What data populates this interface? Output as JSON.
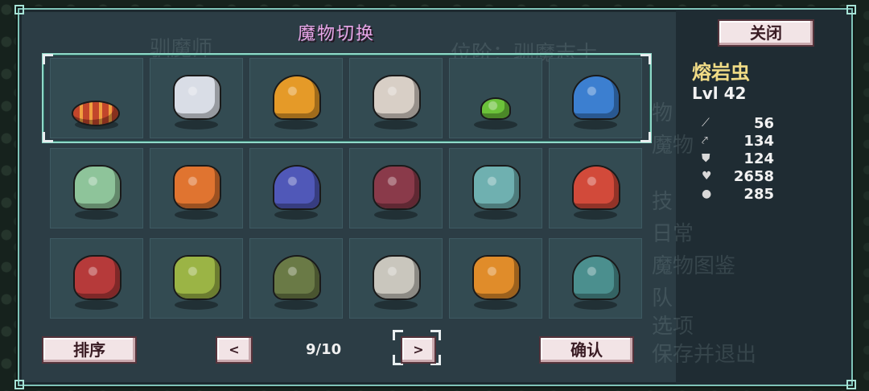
{
  "dialog": {
    "title": "魔物切换",
    "close_label": "关闭",
    "sort_label": "排序",
    "confirm_label": "确认",
    "prev_label": "<",
    "next_label": ">",
    "page_indicator": "9/10"
  },
  "selected_monster": {
    "name": "熔岩虫",
    "level": "Lvl 42",
    "stats": [
      {
        "icon": "sword-icon",
        "value": "56"
      },
      {
        "icon": "pickaxe-icon",
        "value": "134"
      },
      {
        "icon": "shield-icon",
        "value": "124"
      },
      {
        "icon": "heart-icon",
        "value": "2658"
      },
      {
        "icon": "mana-icon",
        "value": "285"
      }
    ]
  },
  "monsters": [
    {
      "id": "lava-worm",
      "color": "#c2462b"
    },
    {
      "id": "cat-knight",
      "color": "#d9dde6"
    },
    {
      "id": "fire-bird",
      "color": "#e59a28"
    },
    {
      "id": "rock-golem",
      "color": "#d8cfc6"
    },
    {
      "id": "green-slime",
      "color": "#6cc23a"
    },
    {
      "id": "blue-wolf",
      "color": "#3c7fd0"
    },
    {
      "id": "plant-beast",
      "color": "#8ec49a"
    },
    {
      "id": "magma-lion",
      "color": "#e07430"
    },
    {
      "id": "shadow-mage",
      "color": "#5058b8"
    },
    {
      "id": "horned-demon",
      "color": "#8a3a4a"
    },
    {
      "id": "water-spirit",
      "color": "#6fb0b0"
    },
    {
      "id": "mushroom-druid",
      "color": "#d24a3a"
    },
    {
      "id": "red-drake",
      "color": "#b63a3a"
    },
    {
      "id": "plume-dino",
      "color": "#9bb445"
    },
    {
      "id": "sea-turtle",
      "color": "#6a7a46"
    },
    {
      "id": "bone-crawler",
      "color": "#c9c6bd"
    },
    {
      "id": "ember-moth",
      "color": "#e08c2a"
    },
    {
      "id": "teal-dragon",
      "color": "#4b8f8e"
    }
  ]
}
